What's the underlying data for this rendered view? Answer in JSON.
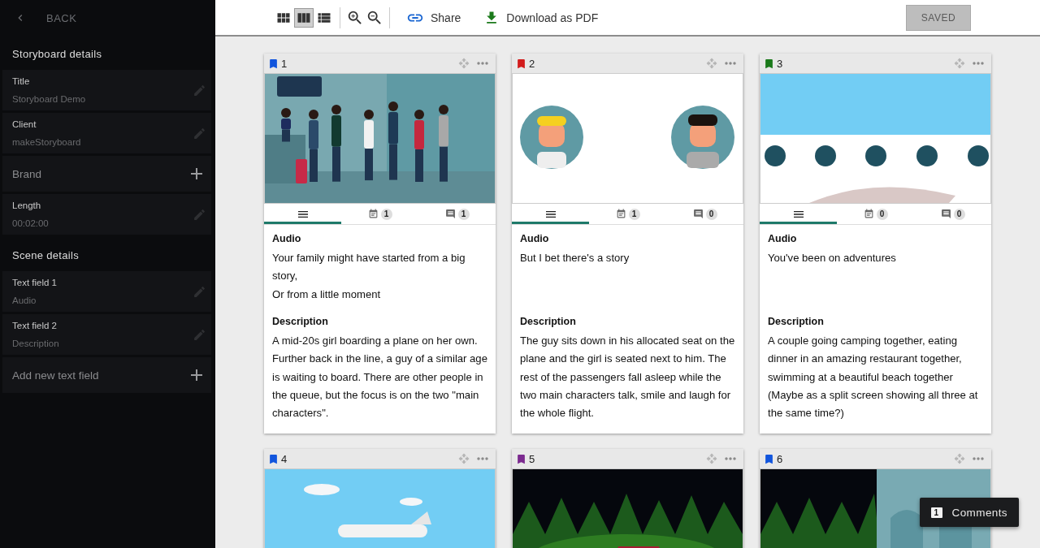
{
  "sidebar": {
    "back": {
      "label": "BACK",
      "disabled": true
    },
    "sections": [
      {
        "title": "Storyboard details",
        "fields": [
          {
            "kind": "value",
            "label": "Title",
            "value": "Storyboard Demo"
          },
          {
            "kind": "value",
            "label": "Client",
            "value": "makeStoryboard"
          },
          {
            "kind": "add",
            "label": "Brand"
          },
          {
            "kind": "value",
            "label": "Length",
            "value": "00:02:00"
          }
        ]
      },
      {
        "title": "Scene details",
        "fields": [
          {
            "kind": "value",
            "label": "Text field 1",
            "value": "Audio"
          },
          {
            "kind": "value",
            "label": "Text field 2",
            "value": "Description"
          },
          {
            "kind": "add",
            "label": "Add new text field"
          }
        ]
      }
    ]
  },
  "toolbar": {
    "views": [
      {
        "kind": "grid",
        "selected": false
      },
      {
        "kind": "columns",
        "selected": true
      },
      {
        "kind": "list",
        "selected": false
      }
    ],
    "share": "Share",
    "download": "Download as PDF",
    "save": {
      "label": "SAVED",
      "disabled": true
    }
  },
  "scenes": [
    {
      "number": "1",
      "color": "#1155dd",
      "tabs": [
        {
          "kind": "notes",
          "selected": true
        },
        {
          "kind": "schedule",
          "count": "1",
          "selected": false
        },
        {
          "kind": "comments",
          "count": "1",
          "selected": false
        }
      ],
      "fields": [
        {
          "label": "Audio",
          "text": "Your family might have started from a big story,\nOr from a little moment"
        },
        {
          "label": "Description",
          "text": "A mid-20s girl boarding a plane on her own. Further back in the line, a guy of a similar age is waiting to board. There are other people in the queue, but the focus is on the two \"main characters\"."
        }
      ]
    },
    {
      "number": "2",
      "color": "#d21c1c",
      "tabs": [
        {
          "kind": "notes",
          "selected": true
        },
        {
          "kind": "schedule",
          "count": "1",
          "selected": false
        },
        {
          "kind": "comments",
          "count": "0",
          "selected": false
        }
      ],
      "fields": [
        {
          "label": "Audio",
          "text": "But I bet there's a story"
        },
        {
          "label": "Description",
          "text": "The guy sits down in his allocated seat on the plane and the girl is seated next to him. The rest of the passengers fall asleep while the two main characters talk, smile and laugh for the whole flight."
        }
      ]
    },
    {
      "number": "3",
      "color": "#1b7a1b",
      "tabs": [
        {
          "kind": "notes",
          "selected": true
        },
        {
          "kind": "schedule",
          "count": "0",
          "selected": false
        },
        {
          "kind": "comments",
          "count": "0",
          "selected": false
        }
      ],
      "fields": [
        {
          "label": "Audio",
          "text": "You've been on adventures"
        },
        {
          "label": "Description",
          "text": "A couple going camping together, eating dinner in an amazing restaurant together, swimming at a beautiful beach together (Maybe as a split screen showing all three at the same time?)"
        }
      ]
    },
    {
      "number": "4",
      "color": "#1155dd"
    },
    {
      "number": "5",
      "color": "#7b2a8f"
    },
    {
      "number": "6",
      "color": "#1155dd"
    }
  ],
  "comments_button": {
    "count": "1",
    "label": "Comments"
  }
}
